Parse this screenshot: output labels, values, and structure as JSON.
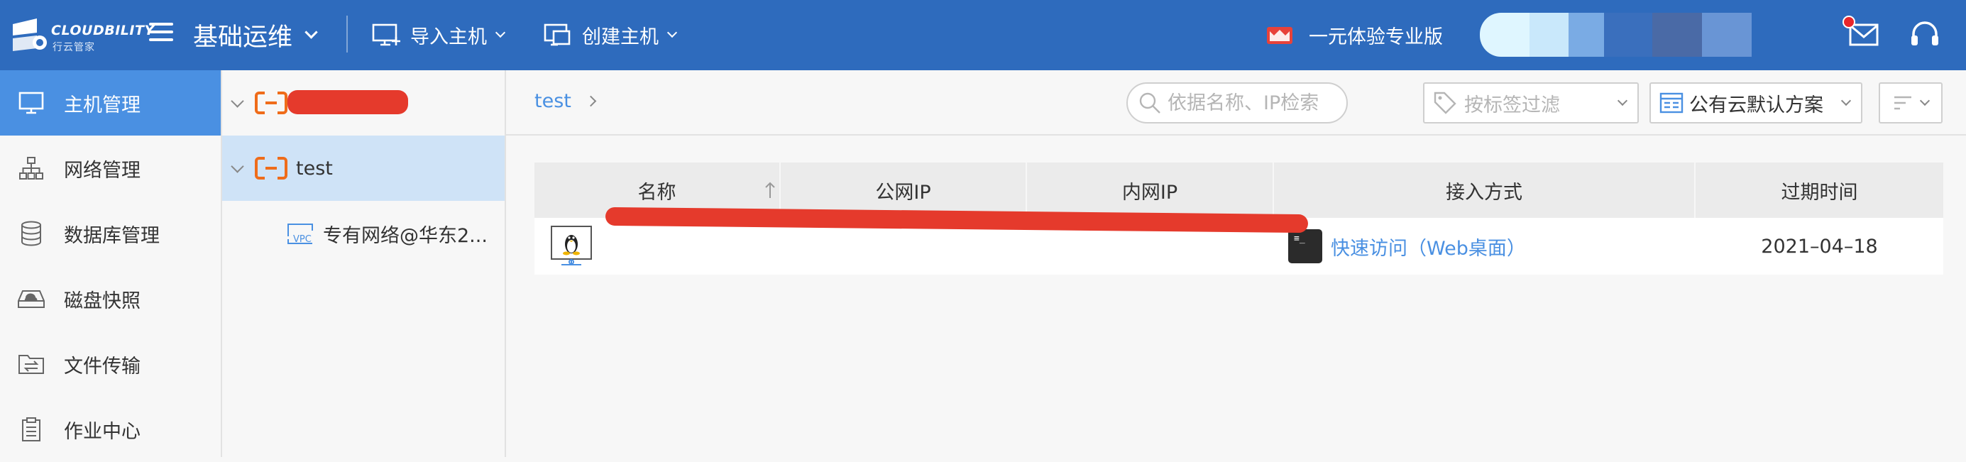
{
  "header": {
    "logo_text": "CLOUDBILITY",
    "logo_sub": "行云管家",
    "module": "基础运维",
    "actions": [
      {
        "label": "导入主机",
        "icon": "monitor-import-icon"
      },
      {
        "label": "创建主机",
        "icon": "monitor-create-icon"
      }
    ],
    "plan_label": "一元体验专业版",
    "icons": [
      "menu-icon",
      "plan-badge-icon",
      "mail-icon",
      "headset-icon"
    ]
  },
  "sidebar": {
    "items": [
      {
        "label": "主机管理",
        "icon": "monitor-icon",
        "active": true
      },
      {
        "label": "网络管理",
        "icon": "network-icon",
        "active": false
      },
      {
        "label": "数据库管理",
        "icon": "database-icon",
        "active": false
      },
      {
        "label": "磁盘快照",
        "icon": "disk-icon",
        "active": false
      },
      {
        "label": "文件传输",
        "icon": "folder-transfer-icon",
        "active": false
      },
      {
        "label": "作业中心",
        "icon": "clipboard-icon",
        "active": false
      }
    ]
  },
  "tree": {
    "nodes": [
      {
        "label": "",
        "redacted": true,
        "icon": "aliyun-icon"
      },
      {
        "label": "test",
        "icon": "aliyun-icon",
        "selected": true
      },
      {
        "label": "专有网络@华东2...",
        "icon": "vpc-icon",
        "child": true
      }
    ]
  },
  "main": {
    "breadcrumb": "test",
    "search_placeholder": "依据名称、IP检索",
    "tag_filter_placeholder": "按标签过滤",
    "scheme_label": "公有云默认方案"
  },
  "table": {
    "columns": [
      "名称",
      "公网IP",
      "内网IP",
      "接入方式",
      "过期时间"
    ],
    "rows": [
      {
        "name": "",
        "public_ip": "",
        "private_ip": "",
        "access": "快速访问（Web桌面）",
        "expire": "2021–04–18",
        "os_icon": "linux-icon"
      }
    ]
  },
  "colors": {
    "header_bg": "#2e6bbd",
    "active_nav": "#4a90e2",
    "link": "#4a90e2",
    "redaction": "#e53a2c",
    "tree_selected": "#cfe3f7"
  }
}
